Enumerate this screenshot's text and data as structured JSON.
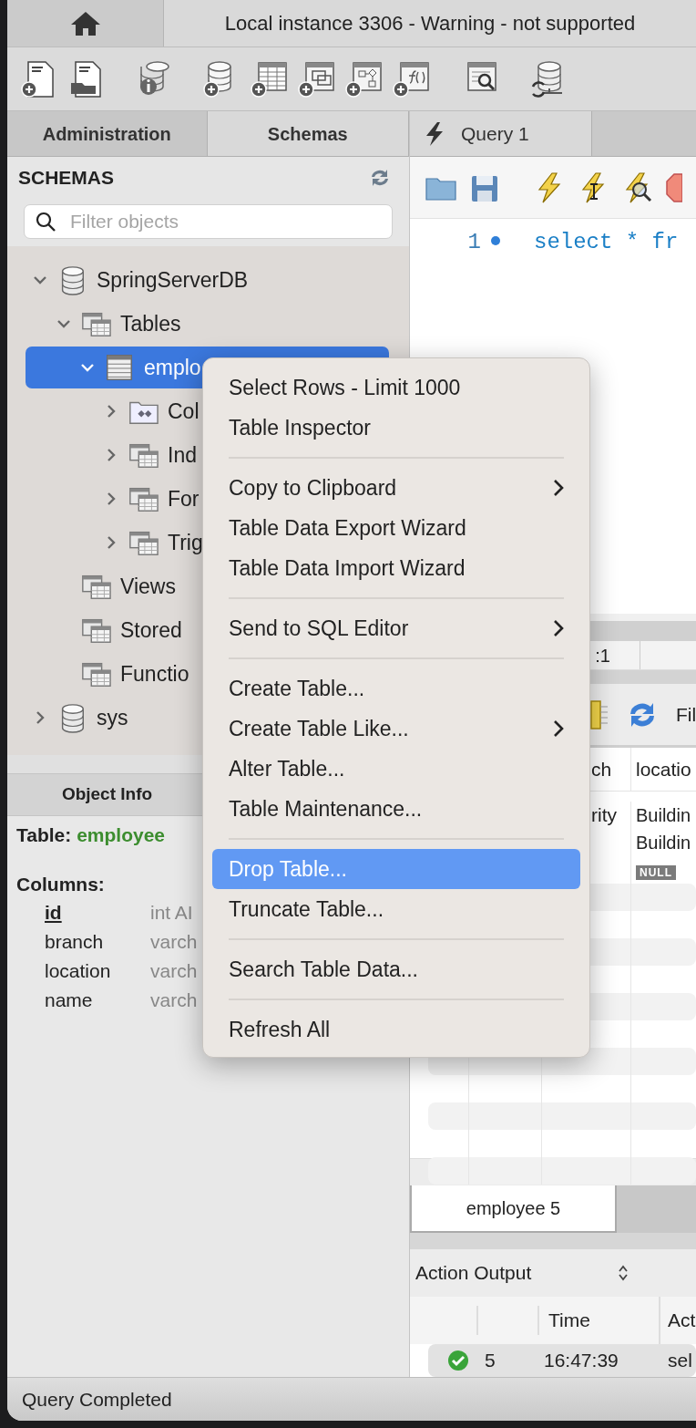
{
  "window": {
    "title": "Local instance 3306 - Warning - not supported"
  },
  "sidebar_tabs": [
    {
      "label": "Administration",
      "selected": false
    },
    {
      "label": "Schemas",
      "selected": true
    }
  ],
  "schemas_panel": {
    "title": "SCHEMAS",
    "filter": {
      "placeholder": "Filter objects"
    },
    "tree": [
      {
        "label": "SpringServerDB",
        "kind": "schema",
        "expanded": true,
        "selected": false,
        "children": [
          {
            "label": "Tables",
            "kind": "group",
            "expanded": true,
            "selected": false,
            "children": [
              {
                "label": "emplo",
                "kind": "table",
                "expanded": true,
                "selected": true,
                "children": [
                  {
                    "label": "Col",
                    "kind": "columns",
                    "expanded": false,
                    "selected": false
                  },
                  {
                    "label": "Ind",
                    "kind": "group",
                    "expanded": false,
                    "selected": false
                  },
                  {
                    "label": "For",
                    "kind": "group",
                    "expanded": false,
                    "selected": false
                  },
                  {
                    "label": "Trig",
                    "kind": "group",
                    "expanded": false,
                    "selected": false
                  }
                ]
              }
            ]
          },
          {
            "label": "Views",
            "kind": "group",
            "selected": false
          },
          {
            "label": "Stored",
            "kind": "group",
            "selected": false
          },
          {
            "label": "Functio",
            "kind": "group",
            "selected": false
          }
        ]
      },
      {
        "label": "sys",
        "kind": "schema",
        "expanded": false,
        "selected": false
      }
    ]
  },
  "object_info": {
    "tab": "Object Info",
    "table_label": "Table:",
    "table_name": "employee",
    "columns_label": "Columns:",
    "columns": [
      {
        "name": "id",
        "type": "int AI",
        "primary_key": true
      },
      {
        "name": "branch",
        "type": "varch",
        "primary_key": false
      },
      {
        "name": "location",
        "type": "varch",
        "primary_key": false
      },
      {
        "name": "name",
        "type": "varch",
        "primary_key": false
      }
    ]
  },
  "editor": {
    "tab": "Query 1",
    "lines": [
      {
        "number": "1",
        "code": "select * fr"
      }
    ]
  },
  "cursor_position": ":1",
  "results": {
    "toolbar_label": "Fil",
    "columns": [
      "ch",
      "locatio"
    ],
    "rows": [
      {
        "column_1": "rity",
        "column_2": "Buildin"
      },
      {
        "column_2": "Buildin"
      },
      {
        "column_2": "NULL",
        "column_2_is_null": true
      }
    ]
  },
  "result_tabs": [
    {
      "label": "employee 5",
      "selected": true
    }
  ],
  "output": {
    "selector": "Action Output",
    "columns": [
      "Time",
      "Act"
    ],
    "rows": [
      {
        "success": true,
        "number": "5",
        "time": "16:47:39",
        "action": "sel"
      }
    ]
  },
  "context_menu": {
    "items": [
      {
        "kind": "item",
        "label": "Select Rows - Limit 1000",
        "submenu": false,
        "selected": false
      },
      {
        "kind": "item",
        "label": "Table Inspector",
        "submenu": false,
        "selected": false
      },
      {
        "kind": "separator"
      },
      {
        "kind": "item",
        "label": "Copy to Clipboard",
        "submenu": true,
        "selected": false
      },
      {
        "kind": "item",
        "label": "Table Data Export Wizard",
        "submenu": false,
        "selected": false
      },
      {
        "kind": "item",
        "label": "Table Data Import Wizard",
        "submenu": false,
        "selected": false
      },
      {
        "kind": "separator"
      },
      {
        "kind": "item",
        "label": "Send to SQL Editor",
        "submenu": true,
        "selected": false
      },
      {
        "kind": "separator"
      },
      {
        "kind": "item",
        "label": "Create Table...",
        "submenu": false,
        "selected": false
      },
      {
        "kind": "item",
        "label": "Create Table Like...",
        "submenu": true,
        "selected": false
      },
      {
        "kind": "item",
        "label": "Alter Table...",
        "submenu": false,
        "selected": false
      },
      {
        "kind": "item",
        "label": "Table Maintenance...",
        "submenu": false,
        "selected": false
      },
      {
        "kind": "separator"
      },
      {
        "kind": "item",
        "label": "Drop Table...",
        "submenu": false,
        "selected": true
      },
      {
        "kind": "item",
        "label": "Truncate Table...",
        "submenu": false,
        "selected": false
      },
      {
        "kind": "separator"
      },
      {
        "kind": "item",
        "label": "Search Table Data...",
        "submenu": false,
        "selected": false
      },
      {
        "kind": "separator"
      },
      {
        "kind": "item",
        "label": "Refresh All",
        "submenu": false,
        "selected": false
      }
    ]
  },
  "status_bar": "Query Completed"
}
